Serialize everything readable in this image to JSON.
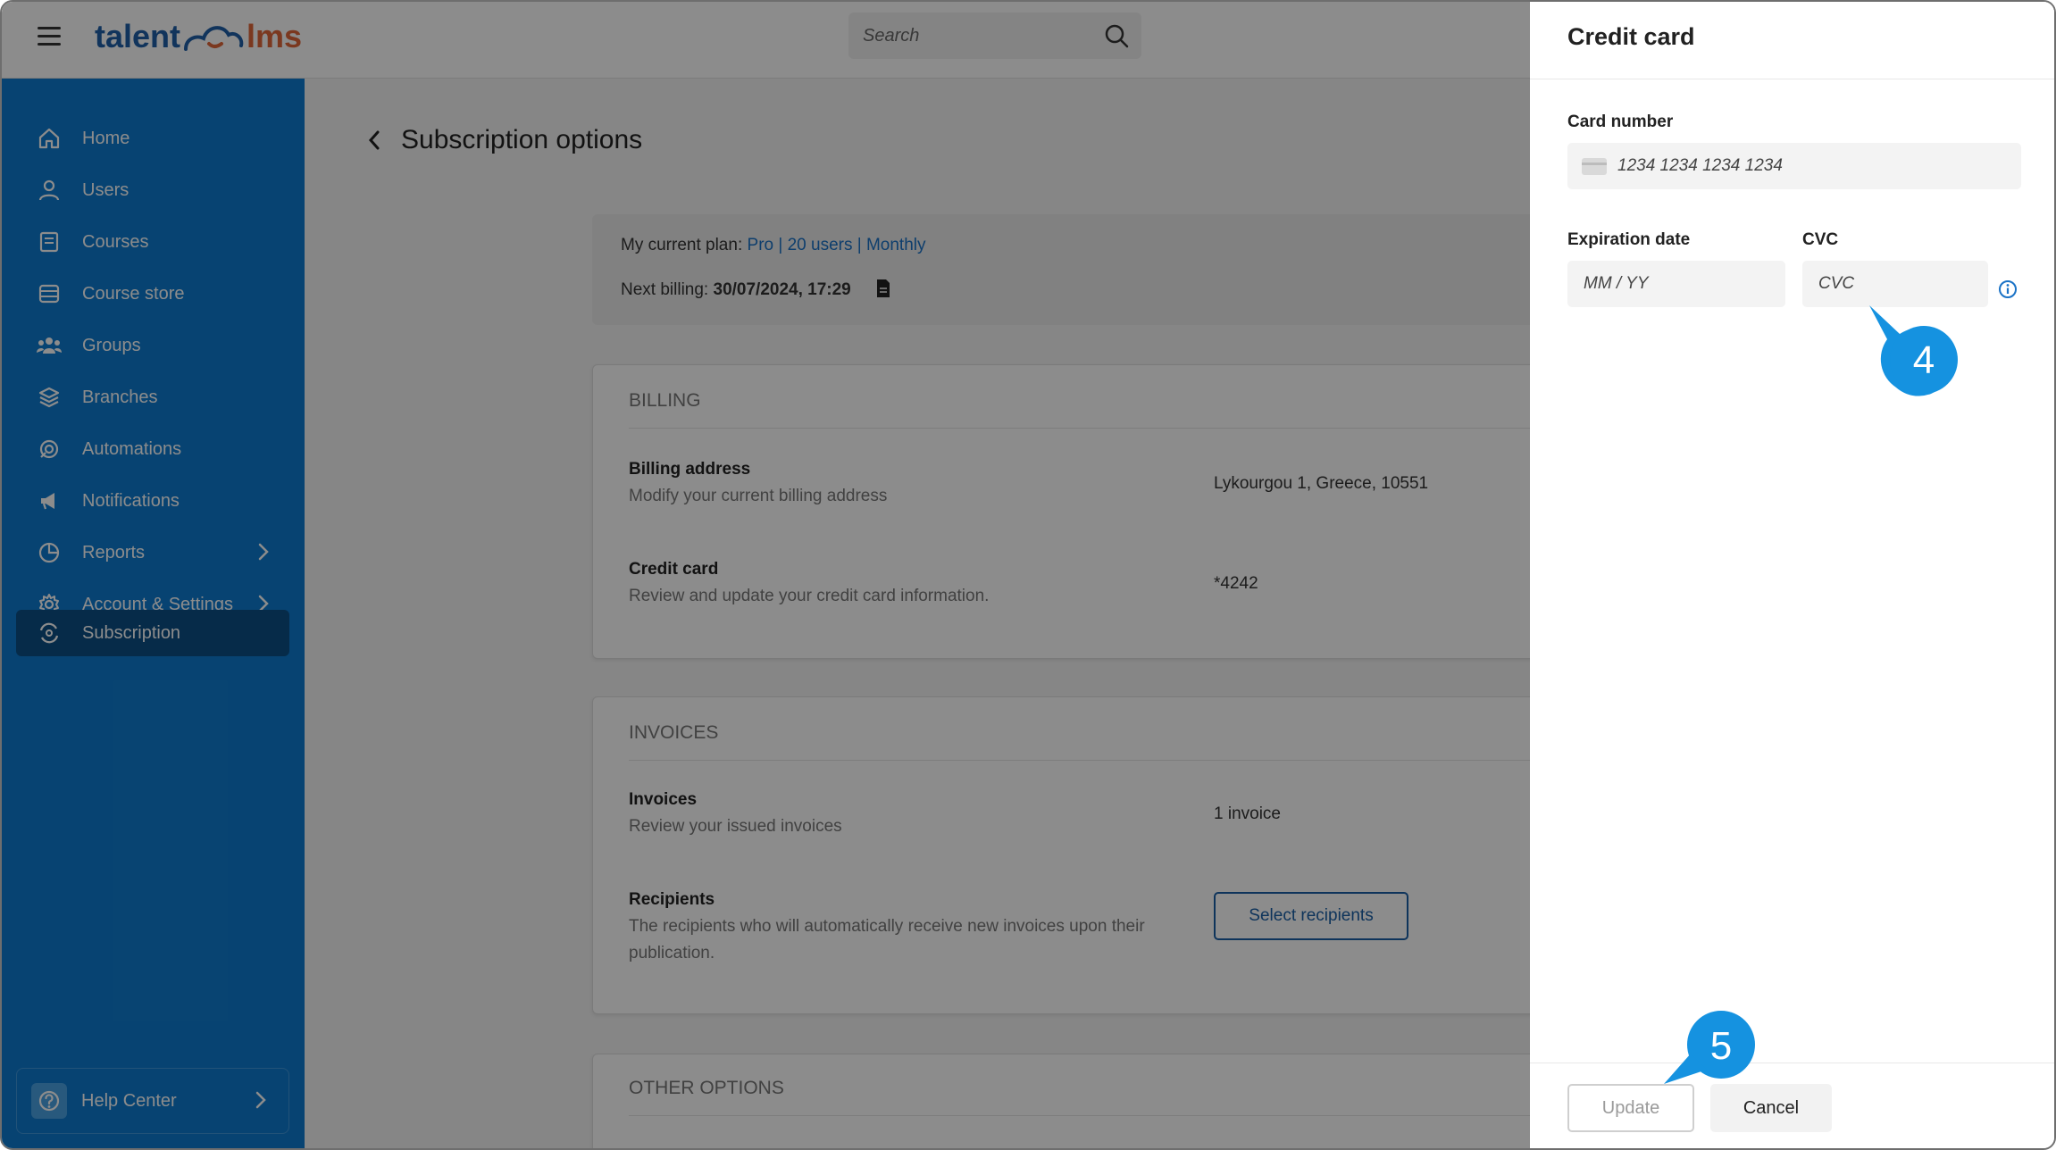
{
  "app": {
    "logo_left": "talent",
    "logo_right": "lms",
    "search_placeholder": "Search"
  },
  "sidebar": {
    "items": [
      {
        "label": "Home",
        "icon": "home-icon"
      },
      {
        "label": "Users",
        "icon": "user-icon"
      },
      {
        "label": "Courses",
        "icon": "book-icon"
      },
      {
        "label": "Course store",
        "icon": "store-icon"
      },
      {
        "label": "Groups",
        "icon": "groups-icon"
      },
      {
        "label": "Branches",
        "icon": "layers-icon"
      },
      {
        "label": "Automations",
        "icon": "automation-icon"
      },
      {
        "label": "Notifications",
        "icon": "megaphone-icon"
      },
      {
        "label": "Reports",
        "icon": "pie-chart-icon"
      },
      {
        "label": "Account & Settings",
        "icon": "gear-icon"
      },
      {
        "label": "Subscription",
        "icon": "subscription-icon"
      }
    ],
    "active": "Subscription",
    "help_label": "Help Center"
  },
  "main": {
    "title": "Subscription options",
    "plan": {
      "label": "My current plan:",
      "plan_name": "Pro",
      "users": "20 users",
      "cycle": "Monthly",
      "sep": "|",
      "next_billing_label": "Next billing:",
      "next_billing_value": "30/07/2024, 17:29"
    },
    "billing": {
      "title": "BILLING",
      "address_title": "Billing address",
      "address_desc": "Modify your current billing address",
      "address_value": "Lykourgou 1, Greece, 10551",
      "card_title": "Credit card",
      "card_desc": "Review and update your credit card information.",
      "card_value": "*4242"
    },
    "invoices": {
      "title": "INVOICES",
      "invoices_title": "Invoices",
      "invoices_desc": "Review your issued invoices",
      "invoices_value": "1 invoice",
      "recipients_title": "Recipients",
      "recipients_desc": "The recipients who will automatically receive new invoices upon their publication.",
      "recipients_button": "Select recipients"
    },
    "other": {
      "title": "OTHER OPTIONS"
    }
  },
  "panel": {
    "title": "Credit card",
    "card_number_label": "Card number",
    "card_number_placeholder": "1234 1234 1234 1234",
    "expiration_label": "Expiration date",
    "expiration_placeholder": "MM / YY",
    "cvc_label": "CVC",
    "cvc_placeholder": "CVC",
    "update_button": "Update",
    "cancel_button": "Cancel"
  },
  "callouts": {
    "step4": "4",
    "step5": "5"
  },
  "colors": {
    "sidebar": "#0e7bd0",
    "sidebar_active": "#0b4f85",
    "link": "#1a72c6",
    "callout": "#1592e0"
  }
}
